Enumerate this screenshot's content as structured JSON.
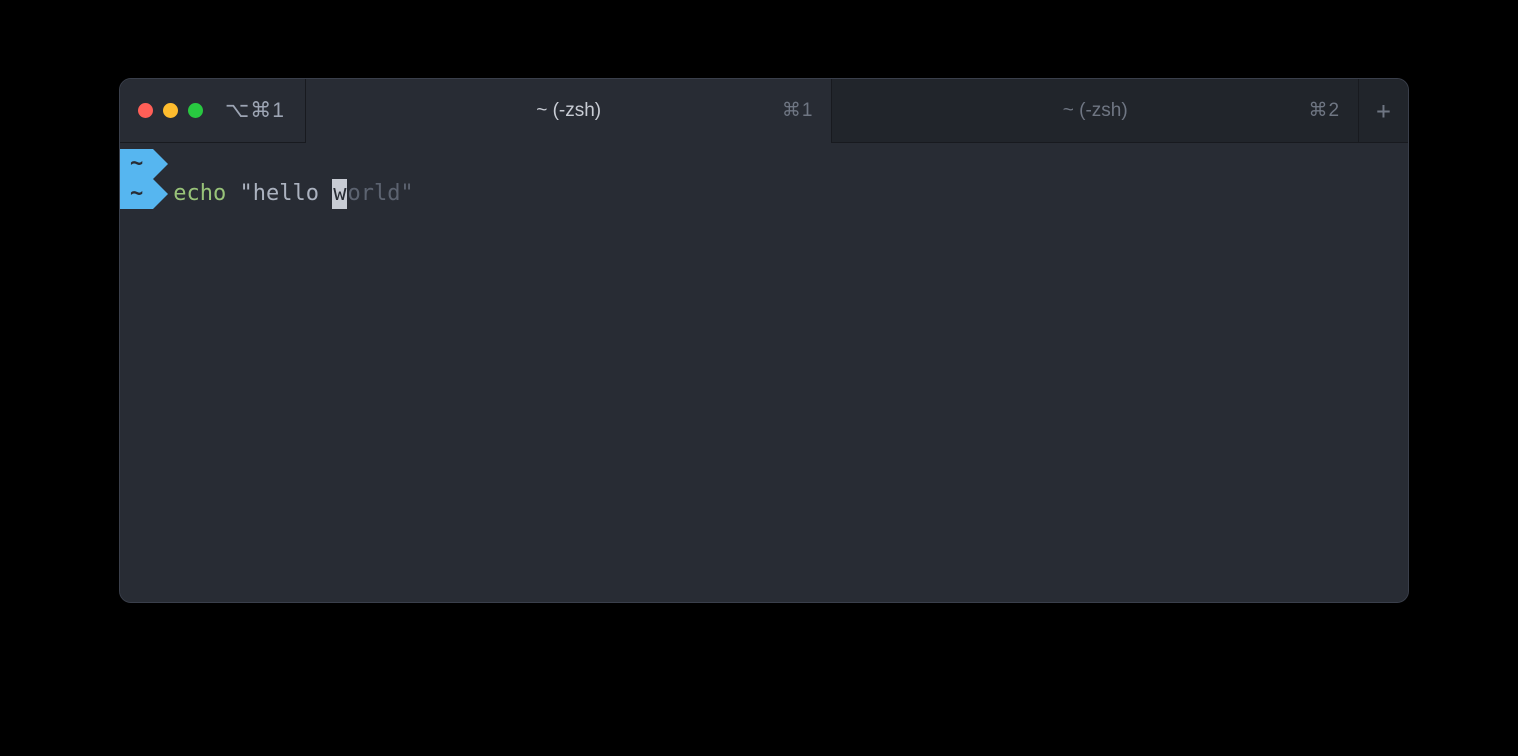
{
  "titlebar": {
    "shortcut_left": "⌥⌘1"
  },
  "tabs": [
    {
      "title": "~ (-zsh)",
      "shortcut": "⌘1",
      "active": true
    },
    {
      "title": "~ (-zsh)",
      "shortcut": "⌘2",
      "active": false
    }
  ],
  "newtab_label": "+",
  "prompt": {
    "badge_line1": "~",
    "badge_line2": "~"
  },
  "command": {
    "cmd_name": "echo",
    "before_cursor": " \"hello ",
    "cursor_char": "w",
    "after_cursor_dim": "orld\""
  }
}
